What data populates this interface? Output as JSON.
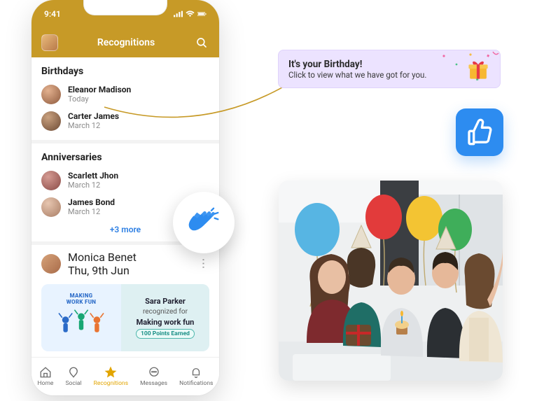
{
  "status": {
    "time": "9:41"
  },
  "header": {
    "title": "Recognitions"
  },
  "sections": {
    "birthdays": {
      "title": "Birthdays",
      "items": [
        {
          "name": "Eleanor Madison",
          "sub": "Today"
        },
        {
          "name": "Carter James",
          "sub": "March 12"
        }
      ]
    },
    "anniversaries": {
      "title": "Anniversaries",
      "items": [
        {
          "name": "Scarlett Jhon",
          "sub": "March 12"
        },
        {
          "name": "James Bond",
          "sub": "March 12"
        }
      ],
      "more": "+3 more"
    }
  },
  "feed": {
    "author": "Monica Benet",
    "date": "Thu, 9th Jun",
    "card": {
      "left_tag_1": "MAKING",
      "left_tag_2": "WORK FUN",
      "recognized_name": "Sara Parker",
      "recognized_text": "recognized for",
      "recognized_for": "Making work fun",
      "points": "100 Points Earned"
    }
  },
  "tabs": {
    "home": "Home",
    "social": "Social",
    "recognitions": "Recognitions",
    "messages": "Messages",
    "notifications": "Notifications"
  },
  "banner": {
    "title": "It's your Birthday!",
    "subtitle": "Click to view what we have got for you."
  },
  "icons": {
    "search": "search-icon",
    "clap": "clap-icon",
    "thumb": "thumbs-up-icon",
    "gift": "gift-icon"
  },
  "colors": {
    "brand": "#c79a27",
    "accent_blue": "#2d8cf0",
    "banner_bg": "#ece3ff",
    "active_tab": "#e2a500",
    "link": "#2d7fe3"
  }
}
